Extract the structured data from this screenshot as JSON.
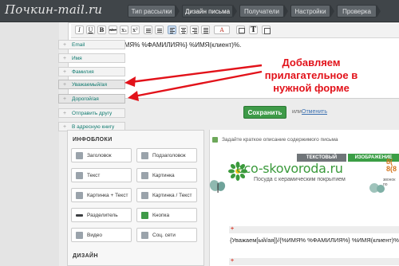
{
  "app": {
    "logo_text": "Почкин-mail.ru"
  },
  "wizard_tabs": [
    "Тип рассылки",
    "Дизайн письма",
    "Получатели",
    "Настройки",
    "Проверка"
  ],
  "toolbar": {
    "italic": "I",
    "underline": "U",
    "bold": "B",
    "strike": "abc",
    "sub": "x₂",
    "sup": "x²",
    "color_picker": "A",
    "text_insert": "T"
  },
  "editor": {
    "content": "ИМЯ% %ФАМИЛИЯ%} %ИМЯ(клиент)%."
  },
  "insert_menu": [
    {
      "label": "Email"
    },
    {
      "label": "Имя"
    },
    {
      "label": "Фамилия"
    },
    {
      "label": "Уважаемый/ая"
    },
    {
      "label": "Дорогой/ая"
    },
    {
      "label": "Отправить другу"
    },
    {
      "label": "В адресную книгу"
    }
  ],
  "annotation": {
    "text": "Добавляем прилагательное в нужной форме",
    "color": "#e2121a"
  },
  "actions": {
    "save_label": "Сохранить",
    "or_label": "или",
    "cancel_label": "Отменить"
  },
  "infoblocks": {
    "title": "ИНФОБЛОКИ",
    "blocks": [
      "Заголовок",
      "Подзаголовок",
      "Текст",
      "Картинка",
      "Картинка + Текст",
      "Картинка / Текст",
      "Разделитель",
      "Кнопка",
      "Видео",
      "Соц. сети"
    ],
    "design_title": "ДИЗАЙН"
  },
  "preview": {
    "hint": "Задайте краткое описание содержимого письма",
    "tab_text": "ТЕКСТОВЫЙ",
    "tab_image": "ИЗОБРАЖЕНИЕ",
    "brand": "eco-skovoroda.ru",
    "brand_sub": "Посуда с керамическим покрытием",
    "phone_a": "8(",
    "phone_b": "8(8",
    "phone_note": "звонок по",
    "body_text": "{Уважаем[ый/ая]}/{%ИМЯ% %ФАМИЛИЯ%} %ИМЯ(клиент)%.",
    "plus": "+"
  },
  "colors": {
    "accent_green": "#3e9a48",
    "annotation_red": "#e2121a",
    "link_teal": "#0f7a6f",
    "topbar": "#404549"
  }
}
